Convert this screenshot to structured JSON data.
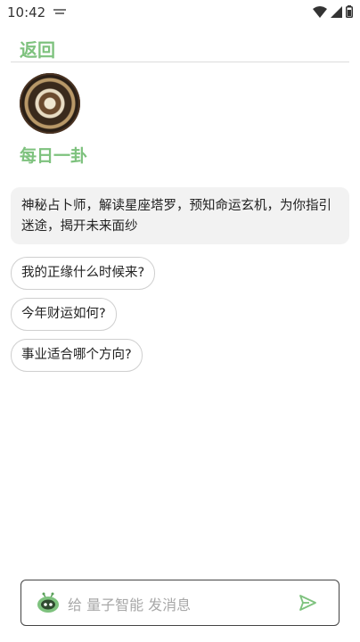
{
  "status_bar": {
    "time": "10:42",
    "icons": [
      "notification-icon",
      "wifi-icon",
      "signal-icon",
      "battery-icon"
    ]
  },
  "header": {
    "back_label": "返回"
  },
  "bot": {
    "name": "每日一卦",
    "avatar": "tarot-clock-avatar",
    "intro": "神秘占卜师，解读星座塔罗，预知命运玄机，为你指引迷途，揭开未来面纱"
  },
  "suggestions": [
    {
      "label": "我的正缘什么时候来?"
    },
    {
      "label": "今年财运如何?"
    },
    {
      "label": "事业适合哪个方向?"
    }
  ],
  "input": {
    "placeholder": "给 量子智能 发消息"
  },
  "colors": {
    "accent": "#7ec27e",
    "bubble_bg": "#f2f2f2"
  }
}
